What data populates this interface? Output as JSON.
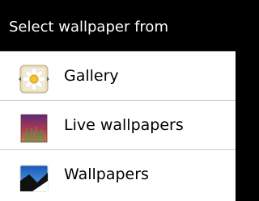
{
  "dialog": {
    "title": "Select wallpaper from"
  },
  "options": [
    {
      "label": "Gallery",
      "icon": "gallery-icon"
    },
    {
      "label": "Live wallpapers",
      "icon": "live-wallpapers-icon"
    },
    {
      "label": "Wallpapers",
      "icon": "wallpapers-icon"
    }
  ],
  "colors": {
    "title_background": "#000000",
    "title_text": "#ffffff",
    "list_background": "#ffffff",
    "divider": "#cfcfcf"
  }
}
